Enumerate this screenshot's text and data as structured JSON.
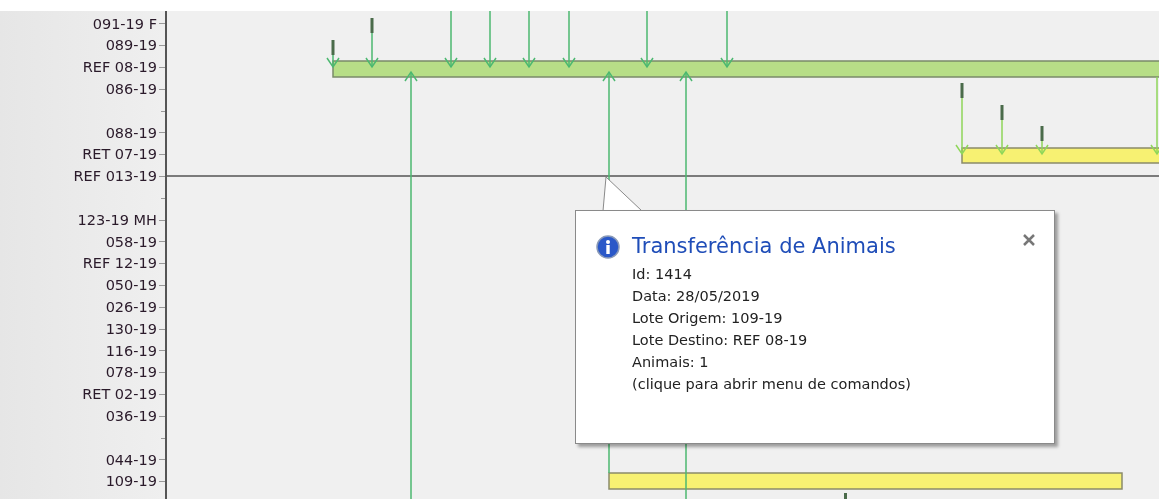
{
  "axis_label_groups": [
    [
      "091-19 F",
      "089-19",
      "REF 08-19",
      "086-19"
    ],
    [
      "088-19",
      "RET 07-19",
      "REF 013-19"
    ],
    [
      "123-19 MH",
      "058-19",
      "REF 12-19",
      "050-19",
      "026-19",
      "130-19",
      "116-19",
      "078-19",
      "RET 02-19",
      "036-19"
    ],
    [
      "044-19",
      "109-19"
    ]
  ],
  "tooltip": {
    "title": "Transferência de Animais",
    "lines": [
      "Id: 1414",
      "Data: 28/05/2019",
      "Lote Origem: 109-19",
      "Lote Destino: REF 08-19",
      "Animais: 1",
      "(clique para abrir menu de comandos)"
    ]
  }
}
